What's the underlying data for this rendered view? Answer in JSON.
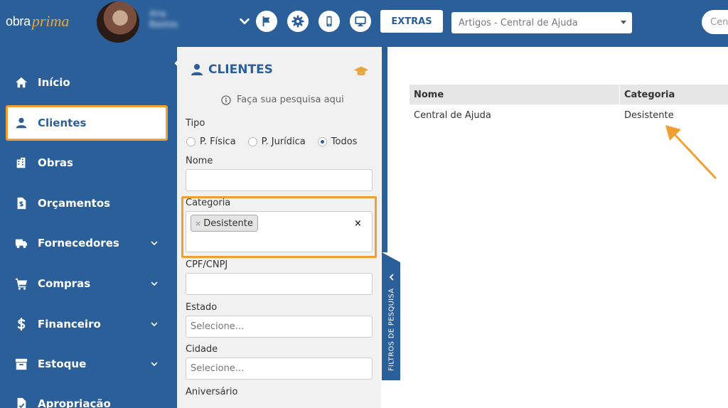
{
  "app": {
    "logo_text_a": "obra",
    "logo_text_b": "prima",
    "user_name_line1": "Ana",
    "user_name_line2": "Bastos"
  },
  "topbar": {
    "extras_label": "EXTRAS",
    "help_select_value": "Artigos - Central de Ajuda",
    "search_text": "Cen",
    "icons": [
      "chevron-down-icon",
      "flag-icon",
      "gear-icon",
      "mobile-icon",
      "desktop-icon"
    ]
  },
  "sidebar": {
    "items": [
      {
        "label": "Início",
        "icon": "home-icon"
      },
      {
        "label": "Clientes",
        "icon": "user-icon"
      },
      {
        "label": "Obras",
        "icon": "building-icon"
      },
      {
        "label": "Orçamentos",
        "icon": "file-dollar-icon"
      },
      {
        "label": "Fornecedores",
        "icon": "truck-icon"
      },
      {
        "label": "Compras",
        "icon": "cart-icon"
      },
      {
        "label": "Financeiro",
        "icon": "dollar-icon"
      },
      {
        "label": "Estoque",
        "icon": "archive-icon"
      },
      {
        "label": "Apropriação",
        "icon": "file-icon"
      }
    ],
    "active": "Clientes"
  },
  "filters": {
    "title": "CLIENTES",
    "hint": "Faça sua pesquisa aqui",
    "tipo_label": "Tipo",
    "tipo_options": [
      "P. Física",
      "P. Jurídica",
      "Todos"
    ],
    "tipo_selected": "Todos",
    "nome_label": "Nome",
    "nome_value": "",
    "categoria_label": "Categoria",
    "categoria_chip": "Desistente",
    "categoria_chip_remove": "×",
    "categoria_clear": "×",
    "cpf_label": "CPF/CNPJ",
    "cpf_value": "",
    "estado_label": "Estado",
    "estado_placeholder": "Selecione...",
    "cidade_label": "Cidade",
    "cidade_placeholder": "Selecione...",
    "aniversario_label": "Aniversário",
    "side_tab_label": "FILTROS DE PESQUISA"
  },
  "results": {
    "columns": [
      "Nome",
      "Categoria"
    ],
    "rows": [
      [
        "Central de Ajuda",
        "Desistente"
      ]
    ]
  },
  "colors": {
    "brand_blue": "#2b5f99",
    "highlight_orange": "#f0a033",
    "logo_accent": "#e8a33a"
  }
}
